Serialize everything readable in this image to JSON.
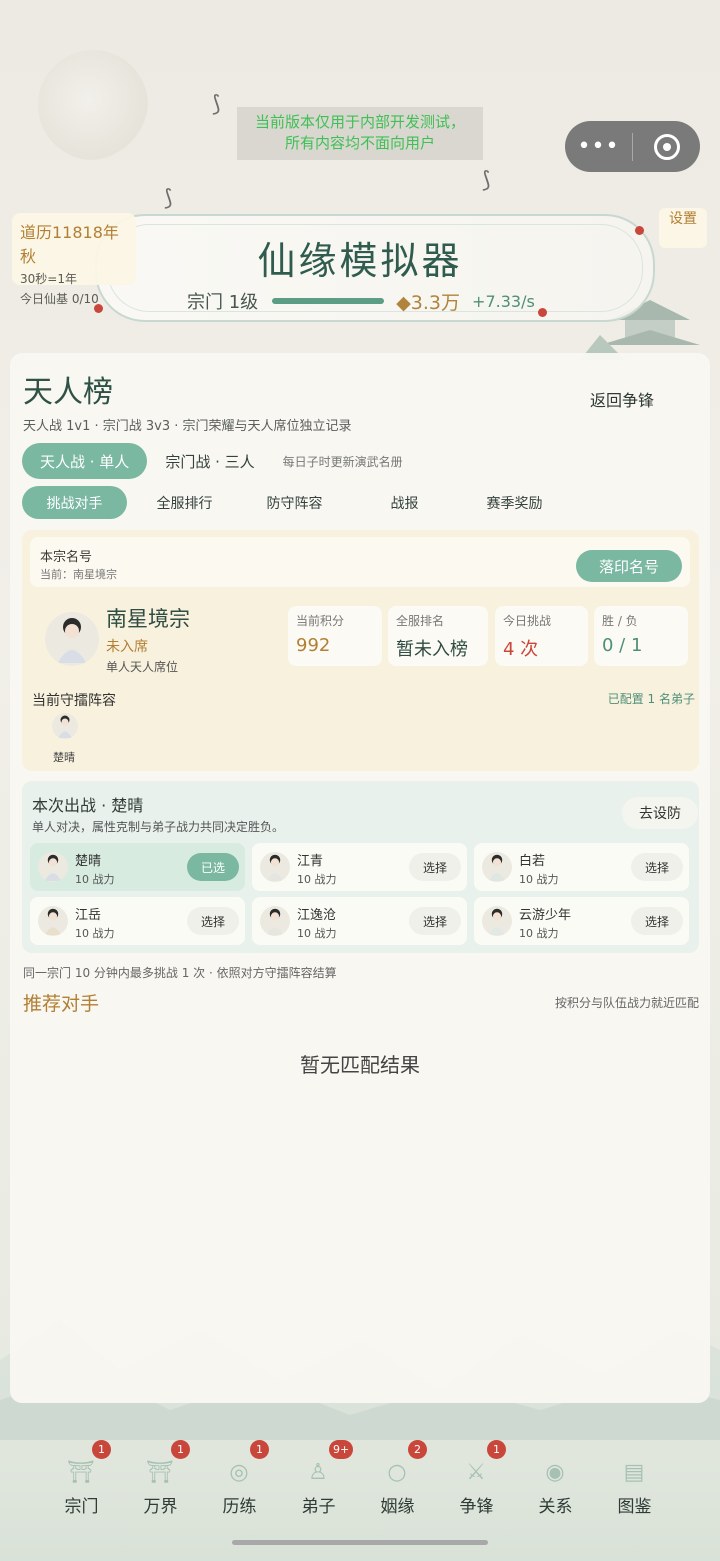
{
  "notice": {
    "line1": "当前版本仅用于内部开发测试，",
    "line2": "所有内容均不面向用户"
  },
  "header": {
    "calendar_line1": "道历11818年秋",
    "calendar_line2": "30秒=1年",
    "calendar_line3": "今日仙基 0/10",
    "settings_label": "设置",
    "app_title": "仙缘模拟器",
    "sect_level": "宗门 1级",
    "spirit_stones": "◆3.3万",
    "rate": "+7.33/s"
  },
  "panel": {
    "title": "天人榜",
    "subtitle": "天人战 1v1 · 宗门战 3v3 · 宗门荣耀与天人席位独立记录",
    "back_button": "返回争锋",
    "mode_tabs": [
      {
        "label": "天人战 · 单人"
      },
      {
        "label": "宗门战 · 三人"
      }
    ],
    "mode_hint": "每日子时更新演武名册",
    "sub_tabs": [
      {
        "label": "挑战对手"
      },
      {
        "label": "全服排行"
      },
      {
        "label": "防守阵容"
      },
      {
        "label": "战报"
      },
      {
        "label": "赛季奖励"
      }
    ]
  },
  "seal": {
    "label": "本宗名号",
    "current": "当前：南星境宗",
    "button": "落印名号",
    "sect_name": "南星境宗",
    "seat_status": "未入席",
    "seat_type": "单人天人席位",
    "stats": [
      {
        "key": "当前积分",
        "value": "992"
      },
      {
        "key": "全服排名",
        "value": "暂未入榜"
      },
      {
        "key": "今日挑战",
        "value": "4 次"
      },
      {
        "key": "胜 / 负",
        "value": "0 / 1"
      }
    ],
    "defense_title": "当前守擂阵容",
    "defense_count": "已配置 1 名弟子",
    "defense_member": "楚晴"
  },
  "battle": {
    "title": "本次出战 · 楚晴",
    "desc": "单人对决，属性克制与弟子战力共同决定胜负。",
    "defend_button": "去设防",
    "disciples": [
      {
        "name": "楚晴",
        "power": "10 战力",
        "button": "已选"
      },
      {
        "name": "江青",
        "power": "10 战力",
        "button": "选择"
      },
      {
        "name": "白若",
        "power": "10 战力",
        "button": "选择"
      },
      {
        "name": "江岳",
        "power": "10 战力",
        "button": "选择"
      },
      {
        "name": "江逸沧",
        "power": "10 战力",
        "button": "选择"
      },
      {
        "name": "云游少年",
        "power": "10 战力",
        "button": "选择"
      }
    ]
  },
  "rule_note": "同一宗门 10 分钟内最多挑战 1 次 · 依照对方守擂阵容结算",
  "recommend": {
    "title": "推荐对手",
    "hint": "按积分与队伍战力就近匹配",
    "empty": "暂无匹配结果"
  },
  "nav": [
    {
      "label": "宗门",
      "badge": "1",
      "icon": "sect-icon"
    },
    {
      "label": "万界",
      "badge": "1",
      "icon": "gate-icon"
    },
    {
      "label": "历练",
      "badge": "1",
      "icon": "journey-icon"
    },
    {
      "label": "弟子",
      "badge": "9+",
      "icon": "disciple-icon"
    },
    {
      "label": "姻缘",
      "badge": "2",
      "icon": "ring-icon"
    },
    {
      "label": "争锋",
      "badge": "1",
      "icon": "swords-icon"
    },
    {
      "label": "关系",
      "badge": "",
      "icon": "jade-icon"
    },
    {
      "label": "图鉴",
      "badge": "",
      "icon": "book-icon"
    }
  ],
  "colors": {
    "accent": "#7ab8a2",
    "gold": "#b27f33",
    "badge": "#c9463a",
    "notice_text": "#3fbf55"
  }
}
